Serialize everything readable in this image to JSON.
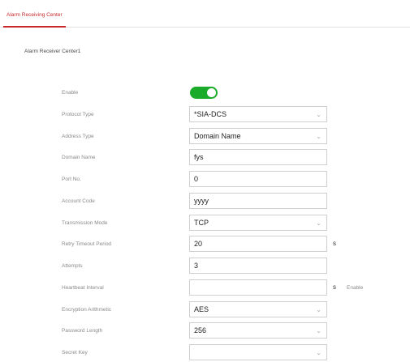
{
  "tab": {
    "label": "Alarm Receiving Center"
  },
  "section": {
    "title": "Alarm Receiver Center1"
  },
  "fields": {
    "enable": {
      "label": "Enable",
      "value": true
    },
    "protocol_type": {
      "label": "Protocol Type",
      "value": "*SIA-DCS"
    },
    "address_type": {
      "label": "Address Type",
      "value": "Domain Name"
    },
    "domain_name": {
      "label": "Domain Name",
      "value": "fys"
    },
    "port_no": {
      "label": "Port No.",
      "value": "0"
    },
    "account_code": {
      "label": "Account Code",
      "value": "yyyy"
    },
    "transmission_mode": {
      "label": "Transmission Mode",
      "value": "TCP"
    },
    "retry_timeout": {
      "label": "Retry Timeout Period",
      "value": "20",
      "unit": "s"
    },
    "attempts": {
      "label": "Attempts",
      "value": "3"
    },
    "heartbeat_interval": {
      "label": "Heartbeat Interval",
      "value": "",
      "unit": "s",
      "extra": "Enable"
    },
    "encryption_algorithm": {
      "label": "Encryption Arithmetic",
      "value": "AES"
    },
    "password_length": {
      "label": "Password Length",
      "value": "256"
    },
    "secret_key": {
      "label": "Secret Key",
      "value": ""
    }
  },
  "colors": {
    "accent": "#c8282a",
    "toggle_on": "#1aab2b"
  }
}
